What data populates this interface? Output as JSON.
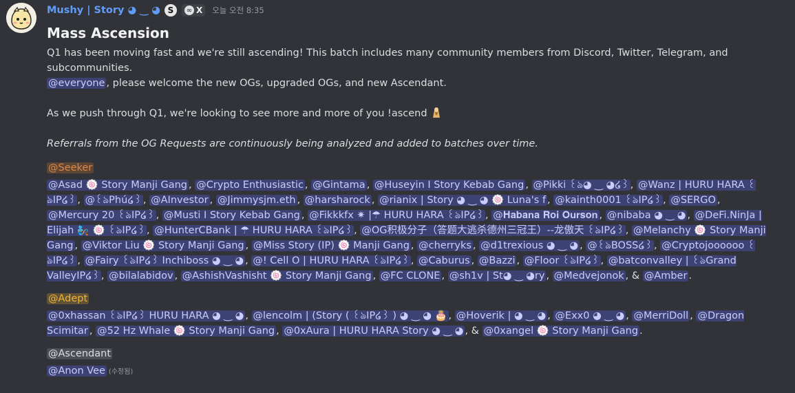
{
  "author": {
    "name": "Mushy | Story ◕ ‿ ◕",
    "role_icon_letter": "S",
    "tag": "X",
    "timestamp": "오늘 오전 8:35"
  },
  "title": "Mass Ascension",
  "intro_prefix": "Q1 has been moving fast and we're still ascending! This batch includes many community members from Discord, Twitter, Telegram, and subcommunities.",
  "everyone_mention": "@everyone",
  "intro_suffix": ", please welcome the new OGs, upgraded OGs, and new Ascendant.",
  "push_text": "As we push through Q1, we're looking to see more and more of you !ascend",
  "referrals_text": "Referrals from the OG Requests are continuously being analyzed and added to batches over time.",
  "seeker": {
    "role": "@Seeker",
    "mentions": [
      "@Asad 🍥 Story Manji Gang",
      "@Crypto Enthusiastic",
      "@Gintama",
      "@Huseyin I Story Kebab Gang",
      "@Pikki ꒰ঌ◕ ‿ ◕໒꒱",
      "@Wanz | HURU HARA ꒰ঌIP໒꒱",
      "@꒰ঌPhú໒꒱",
      "@AInvestor",
      "@Jimmysjm.eth",
      "@harsharock",
      "@rianix | Story ◕ ‿ ◕ 🍥 Luna's f",
      "@kainth0001 ꒰ঌIP໒꒱",
      "@SERGO",
      "@Mercury 20 ꒰ঌIP໒꒱",
      "@Musti I Story Kebab Gang",
      "@Fikkkfx ✷ |☂ HURU HARA ꒰ঌIP໒꒱",
      "@𝐇𝐚𝐛𝐚𝐧𝐚 𝐑𝐨𝐢 𝐎𝐮𝐫𝐬𝐨𝐧",
      "@nibaba ◕ ‿ ◕",
      "@DeFi.NinJa | Elijah 🧞 🍥 ꒰ঌIP໒꒱",
      "@HunterCBank | ☂ HURU HARA ꒰ঌIP໒꒱",
      "@OG积极分子（答题大逃杀德州三冠王）--龙傲天 ꒰ঌIP໒꒱",
      "@Melanchy 🍥 Story Manji Gang",
      "@Viktor Liu 🍥 Story Manji Gang",
      "@Miss Story (IP) 🍥 Manji Gang",
      "@cherryks",
      "@d1trexious ◕ ‿ ◕",
      "@꒰ঌBOSS໒꒱",
      "@Cryptojoooooo ꒰ঌIP໒꒱",
      "@Fairy ꒰ঌIP໒꒱ Inchiboss ◕ ‿ ◕",
      "@! Cell O | HURU HARA ꒰ঌIP໒꒱",
      "@Caburus",
      "@Bazzi",
      "@Floor ꒰ঌIP໒꒱",
      "@batconvalley | ꒰ঌGrand ValleyIP໒꒱",
      "@bilalabidov",
      "@AshishVashisht 🍥 Story Manji Gang",
      "@FC CLONE",
      "@sh1v | St◕ ‿ ◕ry",
      "@Medvejonok",
      "@Amber"
    ]
  },
  "adept": {
    "role": "@Adept",
    "mentions": [
      "@0xhassan ꒰ঌIP໒꒱ HURU HARA ◕ ‿ ◕",
      "@lencolm | (Story ( ꒰ঌIP໒꒱ ) ◕ ‿ ◕ 🎂",
      "@Hoverik | ◕ ‿ ◕",
      "@Exx0 ◕ ‿ ◕",
      "@MerriDoll",
      "@Dragon Scimitar",
      "@52 Hz Whale 🍥 Story Manji Gang",
      "@0xAura | HURU HARA Story ◕ ‿ ◕",
      "@0xangel 🍥 Story Manji Gang"
    ]
  },
  "ascendant": {
    "role": "@Ascendant",
    "mentions": [
      "@Anon Vee"
    ],
    "edited_label": "(수정됨)"
  },
  "separator": ", ",
  "final_and": "& ",
  "period": "."
}
